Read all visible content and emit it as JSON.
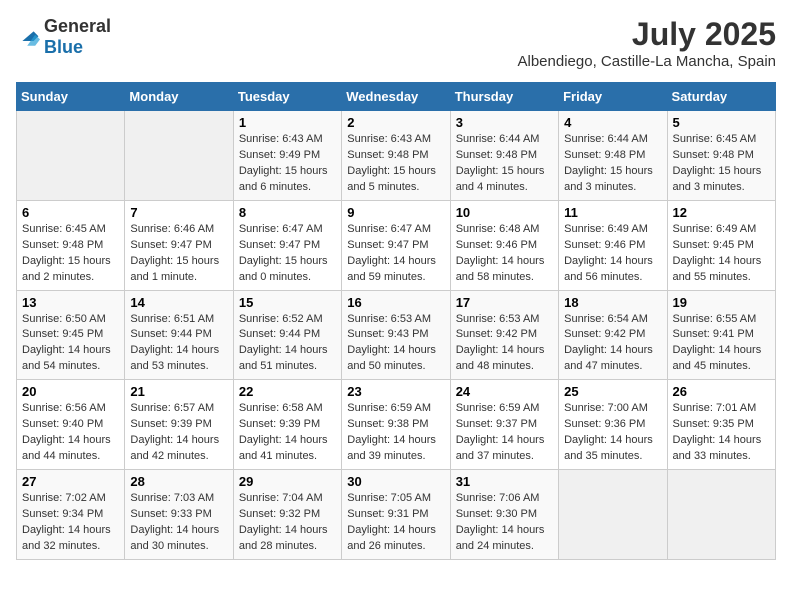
{
  "logo": {
    "general": "General",
    "blue": "Blue"
  },
  "title": {
    "month_year": "July 2025",
    "location": "Albendiego, Castille-La Mancha, Spain"
  },
  "days_of_week": [
    "Sunday",
    "Monday",
    "Tuesday",
    "Wednesday",
    "Thursday",
    "Friday",
    "Saturday"
  ],
  "weeks": [
    [
      {
        "day": "",
        "sunrise": "",
        "sunset": "",
        "daylight": "",
        "empty": true
      },
      {
        "day": "",
        "sunrise": "",
        "sunset": "",
        "daylight": "",
        "empty": true
      },
      {
        "day": "1",
        "sunrise": "Sunrise: 6:43 AM",
        "sunset": "Sunset: 9:49 PM",
        "daylight": "Daylight: 15 hours and 6 minutes.",
        "empty": false
      },
      {
        "day": "2",
        "sunrise": "Sunrise: 6:43 AM",
        "sunset": "Sunset: 9:48 PM",
        "daylight": "Daylight: 15 hours and 5 minutes.",
        "empty": false
      },
      {
        "day": "3",
        "sunrise": "Sunrise: 6:44 AM",
        "sunset": "Sunset: 9:48 PM",
        "daylight": "Daylight: 15 hours and 4 minutes.",
        "empty": false
      },
      {
        "day": "4",
        "sunrise": "Sunrise: 6:44 AM",
        "sunset": "Sunset: 9:48 PM",
        "daylight": "Daylight: 15 hours and 3 minutes.",
        "empty": false
      },
      {
        "day": "5",
        "sunrise": "Sunrise: 6:45 AM",
        "sunset": "Sunset: 9:48 PM",
        "daylight": "Daylight: 15 hours and 3 minutes.",
        "empty": false
      }
    ],
    [
      {
        "day": "6",
        "sunrise": "Sunrise: 6:45 AM",
        "sunset": "Sunset: 9:48 PM",
        "daylight": "Daylight: 15 hours and 2 minutes.",
        "empty": false
      },
      {
        "day": "7",
        "sunrise": "Sunrise: 6:46 AM",
        "sunset": "Sunset: 9:47 PM",
        "daylight": "Daylight: 15 hours and 1 minute.",
        "empty": false
      },
      {
        "day": "8",
        "sunrise": "Sunrise: 6:47 AM",
        "sunset": "Sunset: 9:47 PM",
        "daylight": "Daylight: 15 hours and 0 minutes.",
        "empty": false
      },
      {
        "day": "9",
        "sunrise": "Sunrise: 6:47 AM",
        "sunset": "Sunset: 9:47 PM",
        "daylight": "Daylight: 14 hours and 59 minutes.",
        "empty": false
      },
      {
        "day": "10",
        "sunrise": "Sunrise: 6:48 AM",
        "sunset": "Sunset: 9:46 PM",
        "daylight": "Daylight: 14 hours and 58 minutes.",
        "empty": false
      },
      {
        "day": "11",
        "sunrise": "Sunrise: 6:49 AM",
        "sunset": "Sunset: 9:46 PM",
        "daylight": "Daylight: 14 hours and 56 minutes.",
        "empty": false
      },
      {
        "day": "12",
        "sunrise": "Sunrise: 6:49 AM",
        "sunset": "Sunset: 9:45 PM",
        "daylight": "Daylight: 14 hours and 55 minutes.",
        "empty": false
      }
    ],
    [
      {
        "day": "13",
        "sunrise": "Sunrise: 6:50 AM",
        "sunset": "Sunset: 9:45 PM",
        "daylight": "Daylight: 14 hours and 54 minutes.",
        "empty": false
      },
      {
        "day": "14",
        "sunrise": "Sunrise: 6:51 AM",
        "sunset": "Sunset: 9:44 PM",
        "daylight": "Daylight: 14 hours and 53 minutes.",
        "empty": false
      },
      {
        "day": "15",
        "sunrise": "Sunrise: 6:52 AM",
        "sunset": "Sunset: 9:44 PM",
        "daylight": "Daylight: 14 hours and 51 minutes.",
        "empty": false
      },
      {
        "day": "16",
        "sunrise": "Sunrise: 6:53 AM",
        "sunset": "Sunset: 9:43 PM",
        "daylight": "Daylight: 14 hours and 50 minutes.",
        "empty": false
      },
      {
        "day": "17",
        "sunrise": "Sunrise: 6:53 AM",
        "sunset": "Sunset: 9:42 PM",
        "daylight": "Daylight: 14 hours and 48 minutes.",
        "empty": false
      },
      {
        "day": "18",
        "sunrise": "Sunrise: 6:54 AM",
        "sunset": "Sunset: 9:42 PM",
        "daylight": "Daylight: 14 hours and 47 minutes.",
        "empty": false
      },
      {
        "day": "19",
        "sunrise": "Sunrise: 6:55 AM",
        "sunset": "Sunset: 9:41 PM",
        "daylight": "Daylight: 14 hours and 45 minutes.",
        "empty": false
      }
    ],
    [
      {
        "day": "20",
        "sunrise": "Sunrise: 6:56 AM",
        "sunset": "Sunset: 9:40 PM",
        "daylight": "Daylight: 14 hours and 44 minutes.",
        "empty": false
      },
      {
        "day": "21",
        "sunrise": "Sunrise: 6:57 AM",
        "sunset": "Sunset: 9:39 PM",
        "daylight": "Daylight: 14 hours and 42 minutes.",
        "empty": false
      },
      {
        "day": "22",
        "sunrise": "Sunrise: 6:58 AM",
        "sunset": "Sunset: 9:39 PM",
        "daylight": "Daylight: 14 hours and 41 minutes.",
        "empty": false
      },
      {
        "day": "23",
        "sunrise": "Sunrise: 6:59 AM",
        "sunset": "Sunset: 9:38 PM",
        "daylight": "Daylight: 14 hours and 39 minutes.",
        "empty": false
      },
      {
        "day": "24",
        "sunrise": "Sunrise: 6:59 AM",
        "sunset": "Sunset: 9:37 PM",
        "daylight": "Daylight: 14 hours and 37 minutes.",
        "empty": false
      },
      {
        "day": "25",
        "sunrise": "Sunrise: 7:00 AM",
        "sunset": "Sunset: 9:36 PM",
        "daylight": "Daylight: 14 hours and 35 minutes.",
        "empty": false
      },
      {
        "day": "26",
        "sunrise": "Sunrise: 7:01 AM",
        "sunset": "Sunset: 9:35 PM",
        "daylight": "Daylight: 14 hours and 33 minutes.",
        "empty": false
      }
    ],
    [
      {
        "day": "27",
        "sunrise": "Sunrise: 7:02 AM",
        "sunset": "Sunset: 9:34 PM",
        "daylight": "Daylight: 14 hours and 32 minutes.",
        "empty": false
      },
      {
        "day": "28",
        "sunrise": "Sunrise: 7:03 AM",
        "sunset": "Sunset: 9:33 PM",
        "daylight": "Daylight: 14 hours and 30 minutes.",
        "empty": false
      },
      {
        "day": "29",
        "sunrise": "Sunrise: 7:04 AM",
        "sunset": "Sunset: 9:32 PM",
        "daylight": "Daylight: 14 hours and 28 minutes.",
        "empty": false
      },
      {
        "day": "30",
        "sunrise": "Sunrise: 7:05 AM",
        "sunset": "Sunset: 9:31 PM",
        "daylight": "Daylight: 14 hours and 26 minutes.",
        "empty": false
      },
      {
        "day": "31",
        "sunrise": "Sunrise: 7:06 AM",
        "sunset": "Sunset: 9:30 PM",
        "daylight": "Daylight: 14 hours and 24 minutes.",
        "empty": false
      },
      {
        "day": "",
        "sunrise": "",
        "sunset": "",
        "daylight": "",
        "empty": true
      },
      {
        "day": "",
        "sunrise": "",
        "sunset": "",
        "daylight": "",
        "empty": true
      }
    ]
  ]
}
